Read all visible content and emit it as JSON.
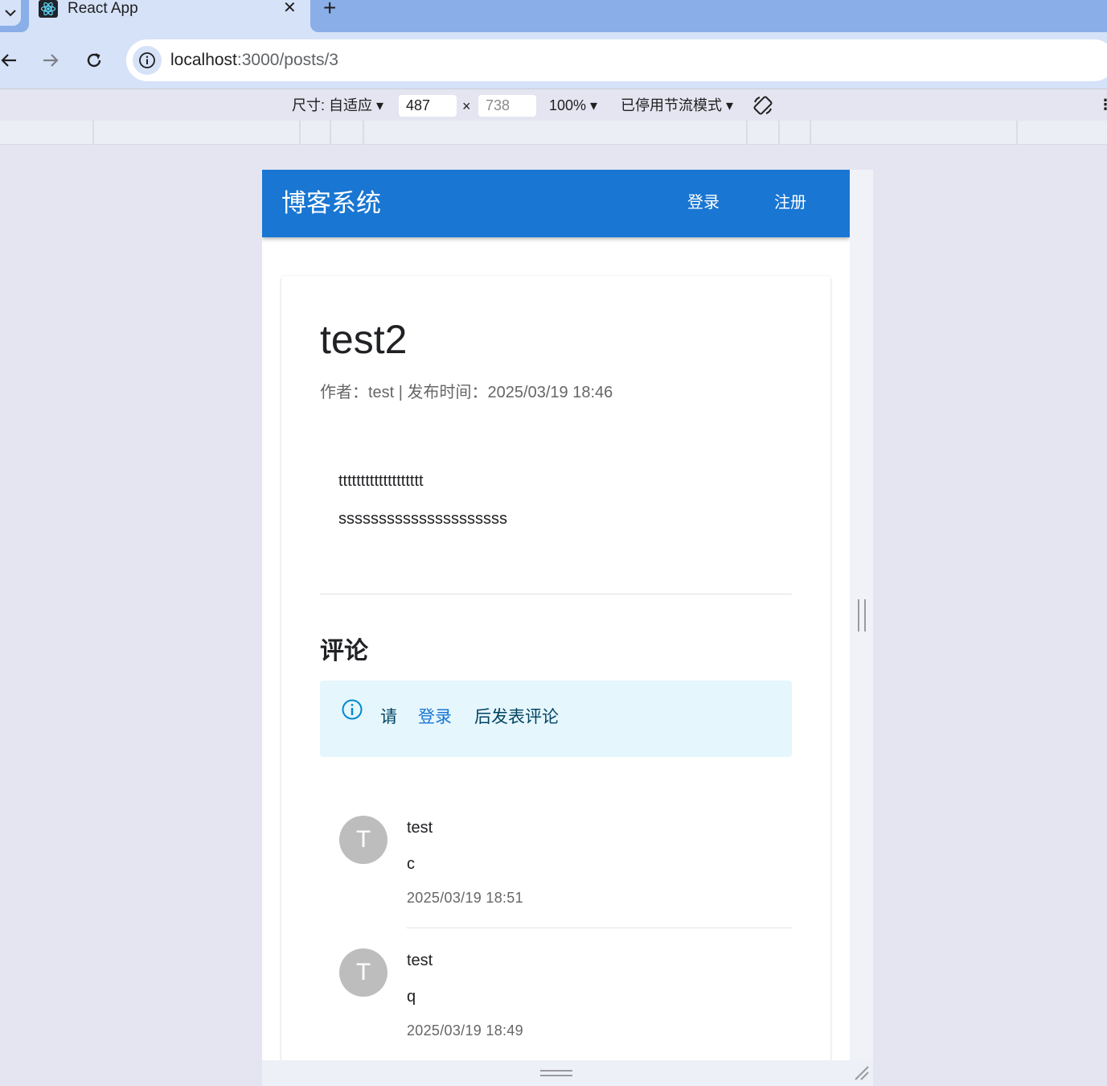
{
  "browser": {
    "tab_title": "React App",
    "tab_close": "✕",
    "new_tab": "+",
    "url_host": "localhost",
    "url_path": ":3000/posts/3"
  },
  "devtools": {
    "size_label": "尺寸: 自适应 ▾",
    "width_value": "487",
    "height_placeholder": "738",
    "times": "×",
    "zoom_label": "100% ▾",
    "throttle_label": "已停用节流模式 ▾",
    "more": "⋮"
  },
  "app": {
    "brand": "博客系统",
    "nav_login": "登录",
    "nav_register": "注册"
  },
  "post": {
    "title": "test2",
    "meta": "作者：test | 发布时间：2025/03/19 18:46",
    "body": [
      "ttttttttttttttttttt",
      "sssssssssssssssssssss"
    ]
  },
  "comments_section": {
    "title": "评论",
    "alert_prefix": "请",
    "alert_link": "登录",
    "alert_suffix": "后发表评论",
    "items": [
      {
        "avatar": "T",
        "author": "test",
        "text": "c",
        "time": "2025/03/19 18:51"
      },
      {
        "avatar": "T",
        "author": "test",
        "text": "q",
        "time": "2025/03/19 18:49"
      }
    ]
  },
  "colors": {
    "appbar": "#1976d2",
    "alert_bg": "#e5f6fd",
    "avatar": "#bdbdbd"
  }
}
